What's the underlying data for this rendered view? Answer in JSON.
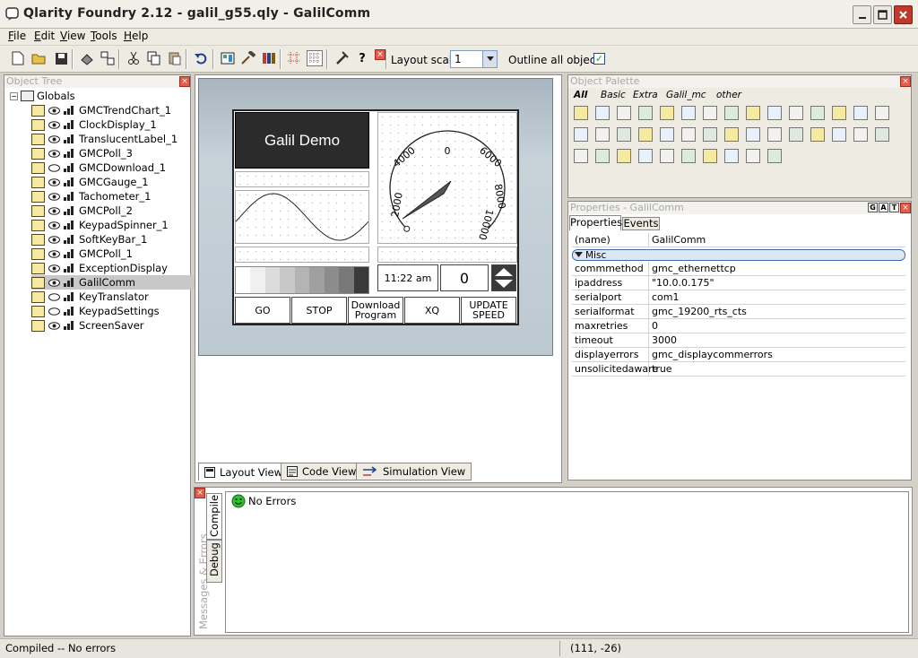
{
  "window": {
    "title": "Qlarity Foundry  2.12 - galil_g55.qly - GalilComm"
  },
  "menu": [
    {
      "letter": "F",
      "rest": "ile"
    },
    {
      "letter": "E",
      "rest": "dit"
    },
    {
      "letter": "V",
      "rest": "iew"
    },
    {
      "letter": "T",
      "rest": "ools"
    },
    {
      "letter": "H",
      "rest": "elp"
    }
  ],
  "toolbar": {
    "layout_scale_label": "Layout scale",
    "layout_scale_value": "1",
    "outline_label": "Outline all objects",
    "outline_checked": true
  },
  "object_tree": {
    "title": "Object Tree",
    "root": "Globals",
    "items": [
      {
        "label": "GMCTrendChart_1",
        "icon": "trend-chart-icon"
      },
      {
        "label": "ClockDisplay_1",
        "icon": "clock-display-icon"
      },
      {
        "label": "TranslucentLabel_1",
        "icon": "label-icon"
      },
      {
        "label": "GMCPoll_3",
        "icon": "poll-icon"
      },
      {
        "label": "GMCDownload_1",
        "icon": "download-icon"
      },
      {
        "label": "GMCGauge_1",
        "icon": "gauge-icon"
      },
      {
        "label": "Tachometer_1",
        "icon": "tachometer-icon"
      },
      {
        "label": "GMCPoll_2",
        "icon": "poll-icon"
      },
      {
        "label": "KeypadSpinner_1",
        "icon": "spinner-icon"
      },
      {
        "label": "SoftKeyBar_1",
        "icon": "softkey-icon"
      },
      {
        "label": "GMCPoll_1",
        "icon": "poll-icon"
      },
      {
        "label": "ExceptionDisplay",
        "icon": "warning-icon"
      },
      {
        "label": "GalilComm",
        "icon": "comm-icon",
        "selected": true
      },
      {
        "label": "KeyTranslator",
        "icon": "key-icon"
      },
      {
        "label": "KeypadSettings",
        "icon": "keypad-icon"
      },
      {
        "label": "ScreenSaver",
        "icon": "screensaver-icon"
      }
    ]
  },
  "device": {
    "title": "Galil Demo",
    "gauge_ticks": [
      "0",
      "2000",
      "4000",
      "6000",
      "8000",
      "10000"
    ],
    "gauge_value": 0,
    "time": "11:22 am",
    "spinner_value": "0",
    "buttons": [
      "GO",
      "STOP",
      "Download Program",
      "XQ",
      "UPDATE SPEED"
    ]
  },
  "view_tabs": [
    "Layout View",
    "Code View",
    "Simulation View"
  ],
  "palette": {
    "title": "Object Palette",
    "tabs": [
      "All",
      "Basic",
      "Extra",
      "Galil_mc",
      "other"
    ]
  },
  "properties": {
    "title": "Properties - GalilComm",
    "tabs": [
      "Properties",
      "Events"
    ],
    "toolbar_buttons": [
      "G",
      "A",
      "T"
    ],
    "name_key": "(name)",
    "name_value": "GalilComm",
    "group": "Misc",
    "rows": [
      {
        "key": "commmethod",
        "value": "gmc_ethernettcp"
      },
      {
        "key": "ipaddress",
        "value": "\"10.0.0.175\""
      },
      {
        "key": "serialport",
        "value": "com1"
      },
      {
        "key": "serialformat",
        "value": "gmc_19200_rts_cts"
      },
      {
        "key": "maxretries",
        "value": "0"
      },
      {
        "key": "timeout",
        "value": "3000"
      },
      {
        "key": "displayerrors",
        "value": "gmc_displaycommerrors"
      },
      {
        "key": "unsolicitedaware",
        "value": "true"
      }
    ]
  },
  "messages": {
    "side_label": "Messages & Errors",
    "tabs": [
      "Compile",
      "Debug"
    ],
    "status": "No Errors"
  },
  "statusbar": {
    "left": "Compiled -- No errors",
    "coords": "(111, -26)"
  }
}
